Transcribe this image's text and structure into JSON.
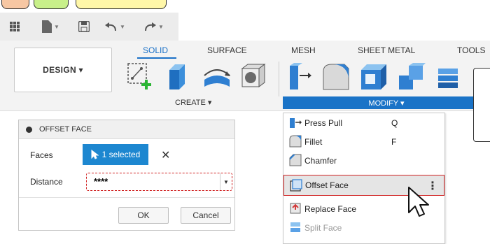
{
  "top_pills": [
    {
      "name": "pill-orange",
      "color": "#f7c7a3"
    },
    {
      "name": "pill-green",
      "color": "#c8f08a"
    },
    {
      "name": "pill-yellow",
      "color": "#fff7a8"
    }
  ],
  "quick_access": {
    "icons": [
      "grid-icon",
      "file-icon",
      "save-icon",
      "undo-icon",
      "redo-icon"
    ]
  },
  "toolbar": {
    "design_label": "DESIGN ▾",
    "tabs": [
      {
        "label": "SOLID",
        "active": true
      },
      {
        "label": "SURFACE"
      },
      {
        "label": "MESH"
      },
      {
        "label": "SHEET METAL"
      },
      {
        "label": "TOOLS"
      }
    ],
    "create_label": "CREATE ▾",
    "modify_label": "MODIFY ▾"
  },
  "panel": {
    "title": "OFFSET FACE",
    "faces_label": "Faces",
    "faces_value": "1 selected",
    "distance_label": "Distance",
    "distance_value": "****",
    "ok_label": "OK",
    "cancel_label": "Cancel"
  },
  "menu": {
    "items": [
      {
        "label": "Press Pull",
        "key": "Q"
      },
      {
        "label": "Fillet",
        "key": "F"
      },
      {
        "label": "Chamfer",
        "key": ""
      },
      {
        "label": "Offset Face",
        "key": ""
      },
      {
        "label": "Replace Face",
        "key": ""
      },
      {
        "label": "Split Face",
        "key": ""
      }
    ]
  },
  "colors": {
    "accent": "#1a73c7",
    "highlight_border": "#d02020"
  }
}
